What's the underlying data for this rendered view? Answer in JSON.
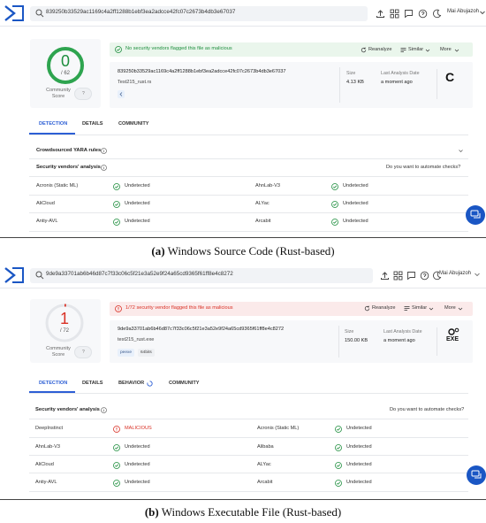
{
  "panel_a": {
    "search_value": "839250b33529ac1169c4a2ff1288b1ebf3ea2adcce42fc07c2673b4db3e67037",
    "user_name": "Mai Abujazoh",
    "score": {
      "flagged": "0",
      "total": "/ 62",
      "community_label_1": "Community",
      "community_label_2": "Score",
      "community_value": "?"
    },
    "banner_text": "No security vendors flagged this file as malicious",
    "actions": {
      "reanalyze": "Reanalyze",
      "similar": "Similar",
      "more": "More"
    },
    "hash": "839250b33529ac1169c4a2ff1288b1ebf3ea2adcce42fc07c2673b4db3e67037",
    "file_name": "Test215_rust.rs",
    "size_label": "Size",
    "size_value": "4.13 KB",
    "last_label": "Last Analysis Date",
    "last_value": "a moment ago",
    "file_type_glyph": "C",
    "tabs": [
      "DETECTION",
      "DETAILS",
      "COMMUNITY"
    ],
    "yara_title": "Crowdsourced YARA rules",
    "vendors_title": "Security vendors' analysis",
    "automate": "Do you want to automate checks?",
    "rows": [
      {
        "v1": "Acronis (Static ML)",
        "r1": "Undetected",
        "v2": "AhnLab-V3",
        "r2": "Undetected"
      },
      {
        "v1": "AliCloud",
        "r1": "Undetected",
        "v2": "ALYac",
        "r2": "Undetected"
      },
      {
        "v1": "Antiy-AVL",
        "r1": "Undetected",
        "v2": "Arcabit",
        "r2": "Undetected"
      }
    ]
  },
  "panel_b": {
    "search_value": "9de9a33701ab6b46d87c7f33c06c5f21e3a52e9f24a65cd9365f61ff8e4c8272",
    "user_name": "Mai Abujazoh",
    "score": {
      "flagged": "1",
      "total": "/ 72",
      "community_label_1": "Community",
      "community_label_2": "Score",
      "community_value": "?"
    },
    "banner_text": "1/72 security vendor flagged this file as malicious",
    "actions": {
      "reanalyze": "Reanalyze",
      "similar": "Similar",
      "more": "More"
    },
    "hash": "9de9a33701ab6b46d87c7f33c06c5f21e3a52e9f24a65cd9365f61ff8e4c8272",
    "file_name": "test215_rust.exe",
    "tag1": "peexe",
    "tag2": "64bits",
    "size_label": "Size",
    "size_value": "150.00 KB",
    "last_label": "Last Analysis Date",
    "last_value": "a moment ago",
    "file_type_glyph": "EXE",
    "tabs": [
      "DETECTION",
      "DETAILS",
      "BEHAVIOR",
      "COMMUNITY"
    ],
    "vendors_title": "Security vendors' analysis",
    "automate": "Do you want to automate checks?",
    "rows": [
      {
        "v1": "DeepInstinct",
        "r1": "MALICIOUS",
        "v2": "Acronis (Static ML)",
        "r2": "Undetected"
      },
      {
        "v1": "AhnLab-V3",
        "r1": "Undetected",
        "v2": "Alibaba",
        "r2": "Undetected"
      },
      {
        "v1": "AliCloud",
        "r1": "Undetected",
        "v2": "ALYac",
        "r2": "Undetected"
      },
      {
        "v1": "Antiy-AVL",
        "r1": "Undetected",
        "v2": "Arcabit",
        "r2": "Undetected"
      }
    ]
  },
  "captions": {
    "a_label": "(a)",
    "a_text": " Windows Source Code (Rust-based)",
    "b_label": "(b)",
    "b_text": " Windows Executable File (Rust-based)"
  },
  "colors": {
    "accent": "#2d5fd5",
    "clean": "#1e8e3e",
    "malicious": "#d93025",
    "brand": "#1a56c4"
  },
  "icons": [
    "virustotal-logo",
    "search-icon",
    "upload-icon",
    "grid-icon",
    "chat-icon",
    "help-icon",
    "moon-icon",
    "chevron-down-icon",
    "check-circle-icon",
    "alert-icon",
    "refresh-icon",
    "similar-icon",
    "info-icon"
  ]
}
